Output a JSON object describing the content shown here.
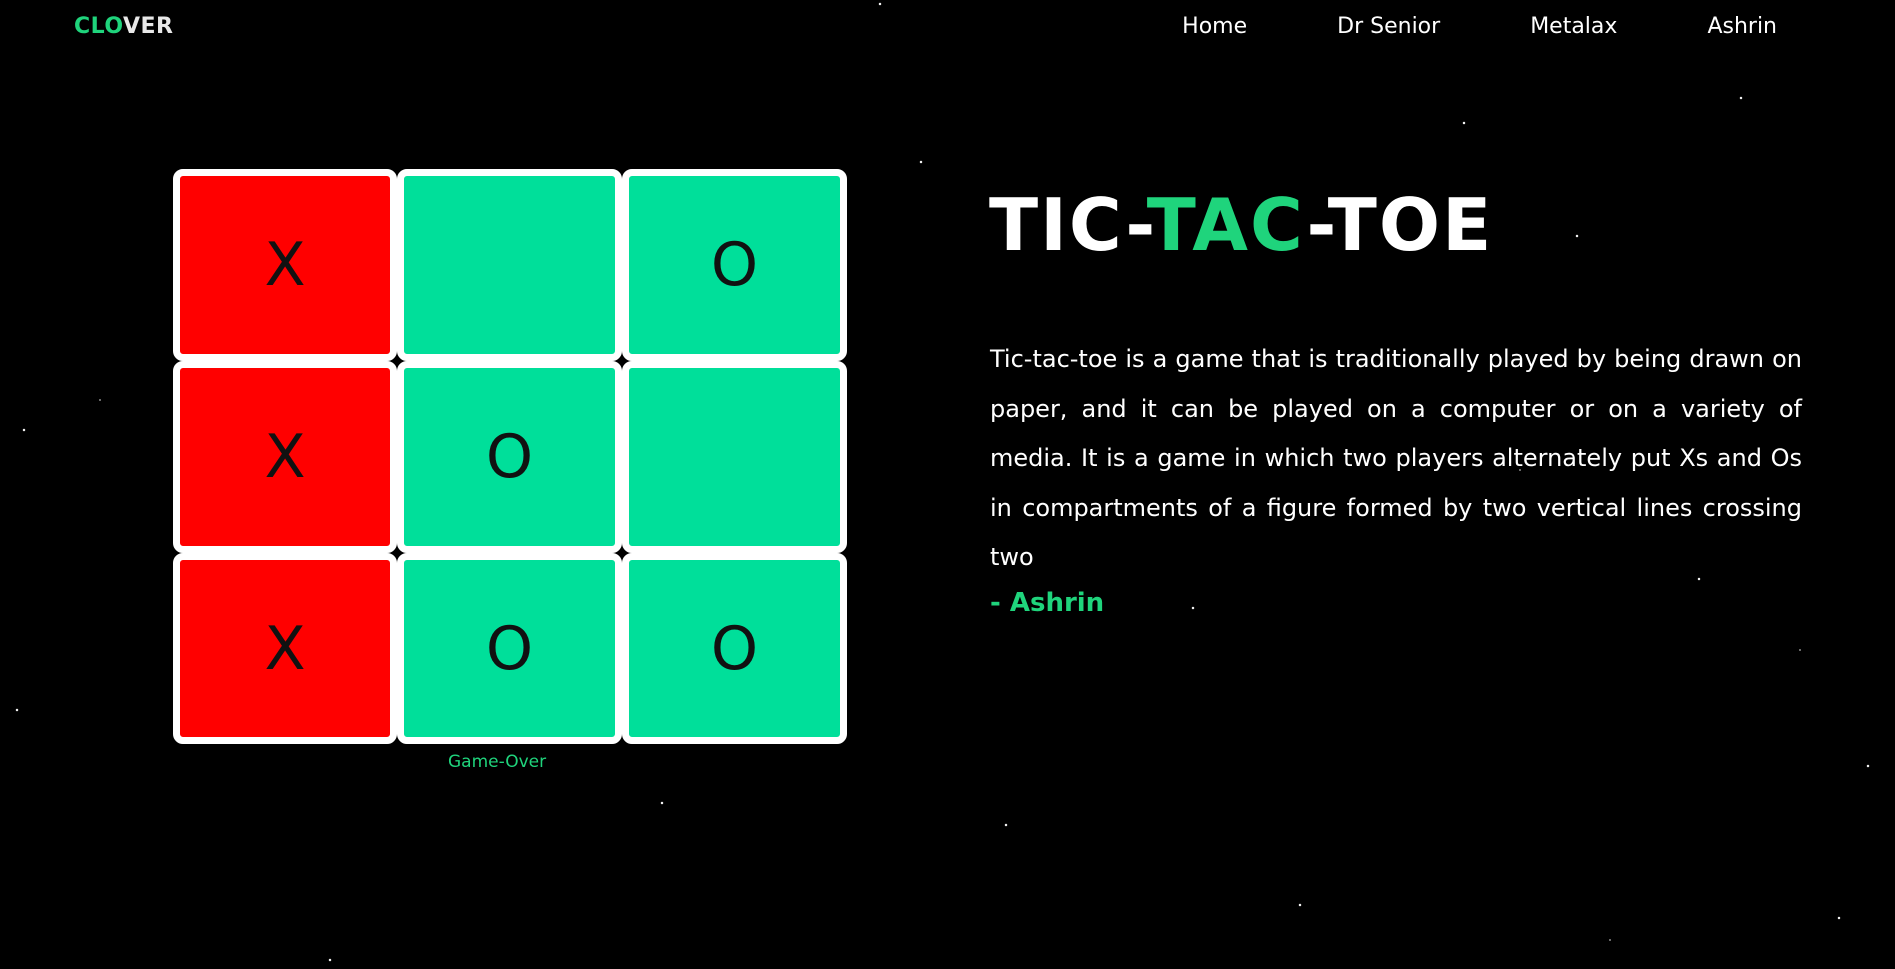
{
  "header": {
    "logo_green": "CLO",
    "logo_white": "VER",
    "nav": [
      "Home",
      "Dr Senior",
      "Metalax",
      "Ashrin"
    ]
  },
  "board": {
    "cells": [
      {
        "mark": "X",
        "state": "win"
      },
      {
        "mark": "",
        "state": "normal"
      },
      {
        "mark": "O",
        "state": "normal"
      },
      {
        "mark": "X",
        "state": "win"
      },
      {
        "mark": "O",
        "state": "normal"
      },
      {
        "mark": "",
        "state": "normal"
      },
      {
        "mark": "X",
        "state": "win"
      },
      {
        "mark": "O",
        "state": "normal"
      },
      {
        "mark": "O",
        "state": "normal"
      }
    ],
    "status": "Game-Over"
  },
  "content": {
    "title_part1": "TIC-",
    "title_part2": "TAC",
    "title_part3": "-TOE",
    "description": "Tic-tac-toe is a game that is traditionally played by being drawn on paper, and it can be played on a computer or on a variety of media. It is a game in which two players alternately put Xs and Os in compartments of a figure formed by two vertical lines crossing two",
    "author": "- Ashrin"
  },
  "colors": {
    "accent": "#1fd47c",
    "cell_green": "#00df9a",
    "cell_red": "#ff0000",
    "background": "#000000"
  }
}
